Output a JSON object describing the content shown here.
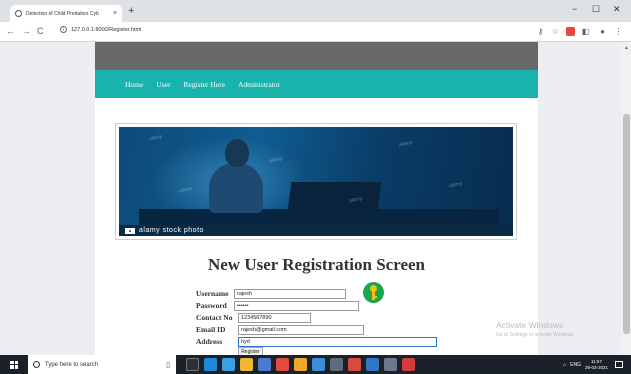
{
  "browser": {
    "tab_title": "Detection of Child Predators Cyb",
    "tab_close": "×",
    "new_tab": "+",
    "url": "127.0.0.1:8000/Register.html",
    "controls": {
      "minimize": "−",
      "maximize": "☐",
      "close": "✕"
    },
    "nav": {
      "back": "←",
      "forward": "→",
      "reload": "C"
    }
  },
  "menu": {
    "items": [
      "Home",
      "User",
      "Register Here",
      "Administrator"
    ]
  },
  "banner": {
    "credit": "alamy stock photo",
    "watermark": "alamy"
  },
  "form": {
    "title": "New User Registration Screen",
    "username_label": "Username",
    "username_value": "rajesh",
    "password_label": "Password",
    "password_value": "••••••",
    "contact_label": "Contact No",
    "contact_value": "1234567890",
    "email_label": "Email ID",
    "email_value": "rajesh@gmail.com",
    "address_label": "Address",
    "address_value": "hyd",
    "register_label": "Register"
  },
  "windows": {
    "activate_title": "Activate Windows",
    "activate_sub": "Go to Settings to activate Windows."
  },
  "taskbar": {
    "search_placeholder": "Type here to search",
    "time": "11:57",
    "date": "29-03-2021",
    "lang": "ENG"
  },
  "colors": {
    "menu_bg": "#18b3ad",
    "header_bg": "#686868",
    "taskbar_bg": "#1b2129"
  }
}
